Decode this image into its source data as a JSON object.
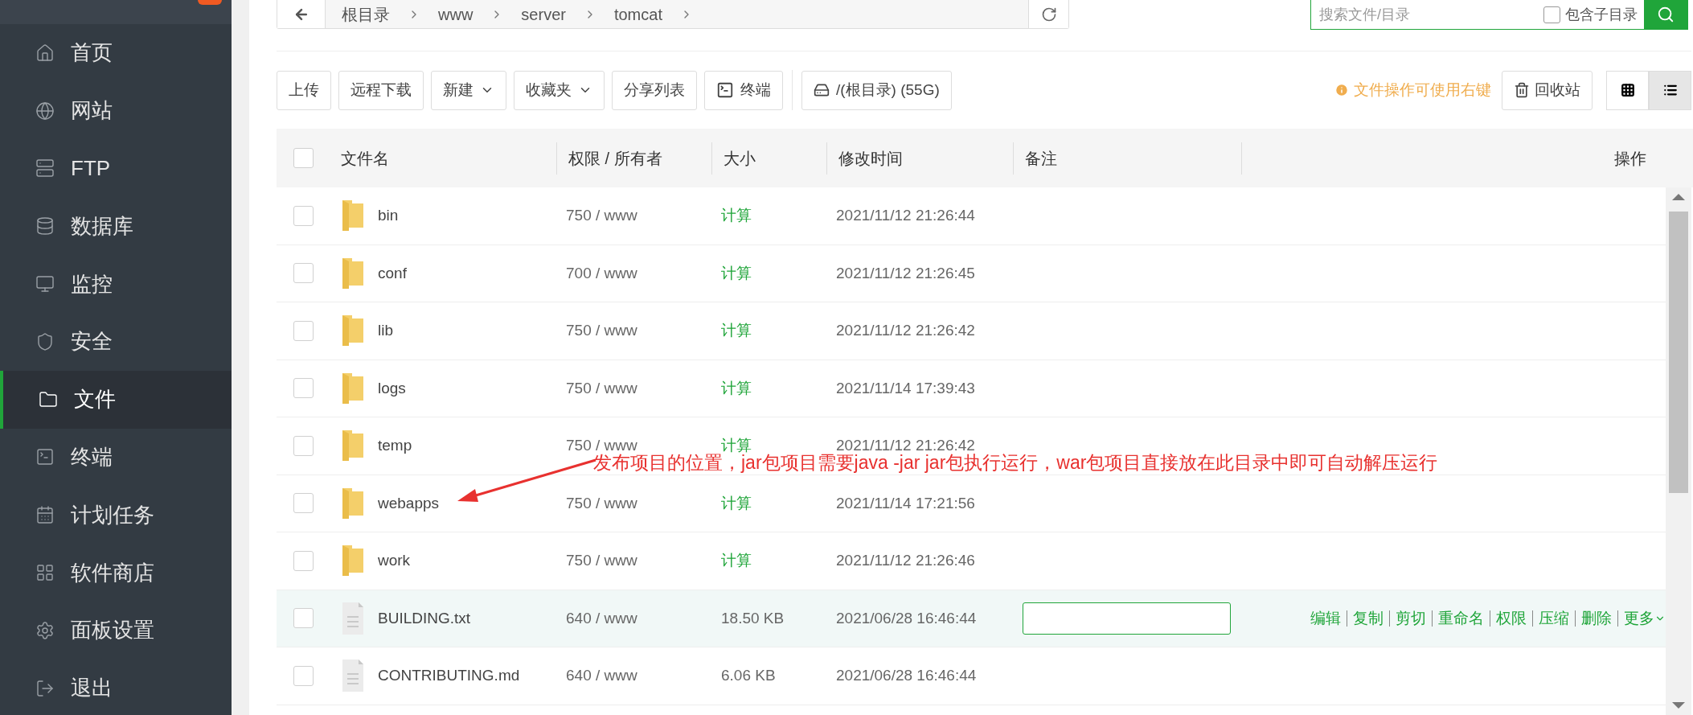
{
  "sidebar": {
    "items": [
      {
        "kind": "home",
        "label": "首页",
        "selected": false
      },
      {
        "kind": "globe",
        "label": "网站",
        "selected": false
      },
      {
        "kind": "ftp",
        "label": "FTP",
        "selected": false
      },
      {
        "kind": "database",
        "label": "数据库",
        "selected": false
      },
      {
        "kind": "monitor",
        "label": "监控",
        "selected": false
      },
      {
        "kind": "shield",
        "label": "安全",
        "selected": false
      },
      {
        "kind": "folder",
        "label": "文件",
        "selected": true
      },
      {
        "kind": "terminal",
        "label": "终端",
        "selected": false
      },
      {
        "kind": "calendar",
        "label": "计划任务",
        "selected": false
      },
      {
        "kind": "apps",
        "label": "软件商店",
        "selected": false
      },
      {
        "kind": "gear",
        "label": "面板设置",
        "selected": false
      },
      {
        "kind": "logout",
        "label": "退出",
        "selected": false
      }
    ]
  },
  "breadcrumb": [
    "根目录",
    "www",
    "server",
    "tomcat"
  ],
  "search": {
    "placeholder": "搜索文件/目录",
    "include_subdirs": {
      "label": "包含子目录",
      "checked": false
    }
  },
  "toolbar": [
    {
      "kind": "plain",
      "label": "上传"
    },
    {
      "kind": "plain",
      "label": "远程下载"
    },
    {
      "kind": "dropdown",
      "label": "新建"
    },
    {
      "kind": "dropdown",
      "label": "收藏夹"
    },
    {
      "kind": "plain",
      "label": "分享列表"
    },
    {
      "kind": "terminal",
      "label": "终端"
    },
    {
      "kind": "disk",
      "label": "/(根目录) (55G)"
    }
  ],
  "hint": "文件操作可使用右键",
  "recycle_bin": "回收站",
  "view_buttons": [
    {
      "kind": "grid",
      "selected": false
    },
    {
      "kind": "list",
      "selected": true
    }
  ],
  "table": {
    "select_all": {
      "checked": false
    },
    "columns": [
      "文件名",
      "权限 / 所有者",
      "大小",
      "修改时间",
      "备注",
      "操作"
    ],
    "rows": [
      {
        "kind": "folder",
        "name": "bin",
        "perms": "750 / www",
        "size": "计算",
        "mtime": "2021/11/12 21:26:44",
        "highlighted": false
      },
      {
        "kind": "folder",
        "name": "conf",
        "perms": "700 / www",
        "size": "计算",
        "mtime": "2021/11/12 21:26:45",
        "highlighted": false
      },
      {
        "kind": "folder",
        "name": "lib",
        "perms": "750 / www",
        "size": "计算",
        "mtime": "2021/11/12 21:26:42",
        "highlighted": false
      },
      {
        "kind": "folder",
        "name": "logs",
        "perms": "750 / www",
        "size": "计算",
        "mtime": "2021/11/14 17:39:43",
        "highlighted": false
      },
      {
        "kind": "folder",
        "name": "temp",
        "perms": "750 / www",
        "size": "计算",
        "mtime": "2021/11/12 21:26:42",
        "highlighted": false
      },
      {
        "kind": "folder",
        "name": "webapps",
        "perms": "750 / www",
        "size": "计算",
        "mtime": "2021/11/14 17:21:56",
        "highlighted": false
      },
      {
        "kind": "folder",
        "name": "work",
        "perms": "750 / www",
        "size": "计算",
        "mtime": "2021/11/12 21:26:46",
        "highlighted": false
      },
      {
        "kind": "file",
        "name": "BUILDING.txt",
        "perms": "640 / www",
        "size": "18.50 KB",
        "mtime": "2021/06/28 16:46:44",
        "highlighted": true,
        "actions": [
          "编辑",
          "复制",
          "剪切",
          "重命名",
          "权限",
          "压缩",
          "删除",
          "更多"
        ]
      },
      {
        "kind": "file",
        "name": "CONTRIBUTING.md",
        "perms": "640 / www",
        "size": "6.06 KB",
        "mtime": "2021/06/28 16:46:44",
        "highlighted": false
      }
    ]
  },
  "annotation": "发布项目的位置，jar包项目需要java -jar jar包执行运行，war包项目直接放在此目录中即可自动解压运行"
}
